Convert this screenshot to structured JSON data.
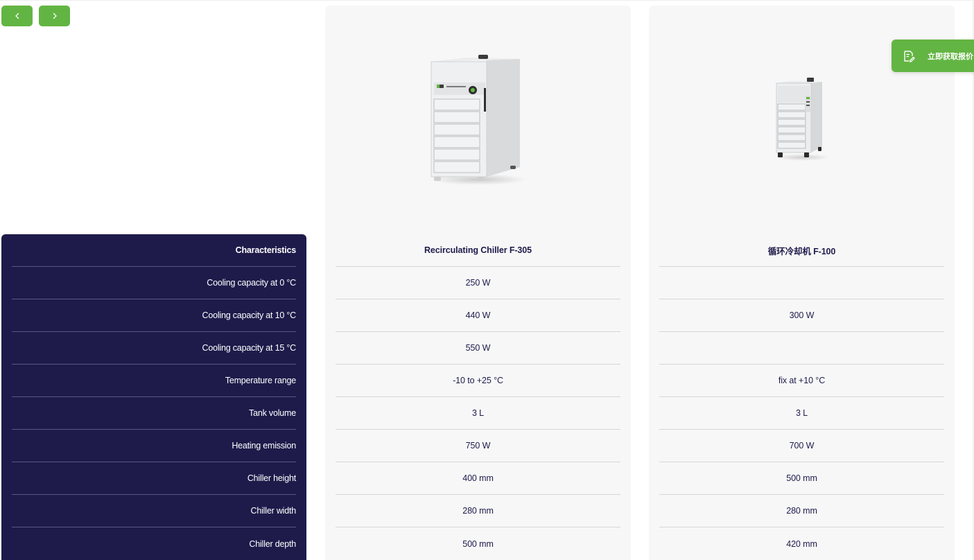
{
  "nav": {
    "prev_label": "‹",
    "next_label": "›"
  },
  "quote": {
    "label": "立即获取报价",
    "icon": "edit-document-icon"
  },
  "characteristics": {
    "header": "Characteristics",
    "rows": [
      "Cooling capacity at 0 °C",
      "Cooling capacity at 10 °C",
      "Cooling capacity at 15 °C",
      "Temperature range",
      "Tank volume",
      "Heating emission",
      "Chiller height",
      "Chiller width",
      "Chiller depth"
    ]
  },
  "products": [
    {
      "name": "Recirculating Chiller F-305",
      "image": "chiller-f305-image",
      "values": [
        "250 W",
        "440 W",
        "550 W",
        "-10 to +25 °C",
        "3 L",
        "750 W",
        "400 mm",
        "280 mm",
        "500 mm"
      ]
    },
    {
      "name": "循环冷却机 F-100",
      "image": "chiller-f100-image",
      "values": [
        "",
        "300 W",
        "",
        "fix at +10 °C",
        "3 L",
        "700 W",
        "500 mm",
        "280 mm",
        "420 mm"
      ]
    }
  ],
  "colors": {
    "accent": "#63b543",
    "navy": "#1e1b4b",
    "card_bg": "#f7f7f7"
  }
}
